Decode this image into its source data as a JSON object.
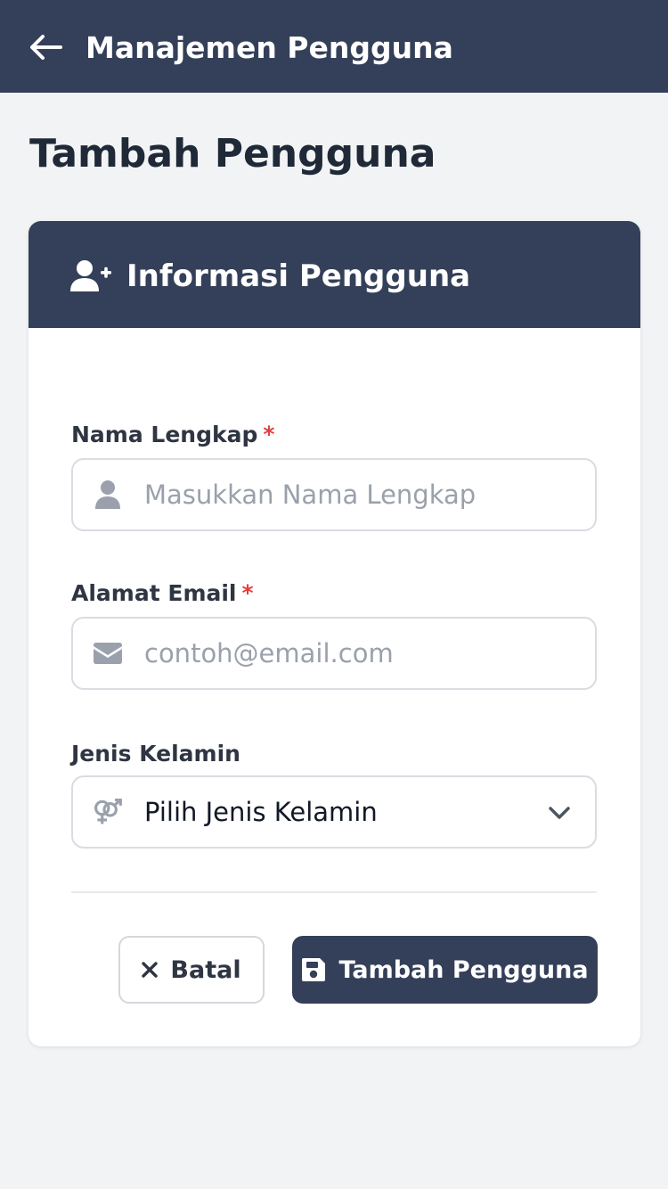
{
  "appbar": {
    "title": "Manajemen Pengguna"
  },
  "page": {
    "title": "Tambah Pengguna"
  },
  "card": {
    "header_title": "Informasi Pengguna"
  },
  "form": {
    "name": {
      "label": "Nama Lengkap",
      "required_mark": "*",
      "placeholder": "Masukkan Nama Lengkap",
      "value": ""
    },
    "email": {
      "label": "Alamat Email",
      "required_mark": "*",
      "placeholder": "contoh@email.com",
      "value": ""
    },
    "gender": {
      "label": "Jenis Kelamin",
      "selected": "Pilih Jenis Kelamin"
    }
  },
  "actions": {
    "cancel_label": "Batal",
    "submit_label": "Tambah Pengguna"
  },
  "icons": {
    "back": "arrow-left-icon",
    "header": "user-plus-icon",
    "name_field": "user-icon",
    "email_field": "envelope-icon",
    "gender_field": "venus-mars-icon",
    "dropdown": "chevron-down-icon",
    "cancel": "close-icon",
    "submit": "save-icon"
  },
  "colors": {
    "primary": "#344059",
    "background": "#f2f3f5",
    "required": "#e53e3e",
    "placeholder": "#9aa1ac",
    "border": "#d9dce1"
  }
}
